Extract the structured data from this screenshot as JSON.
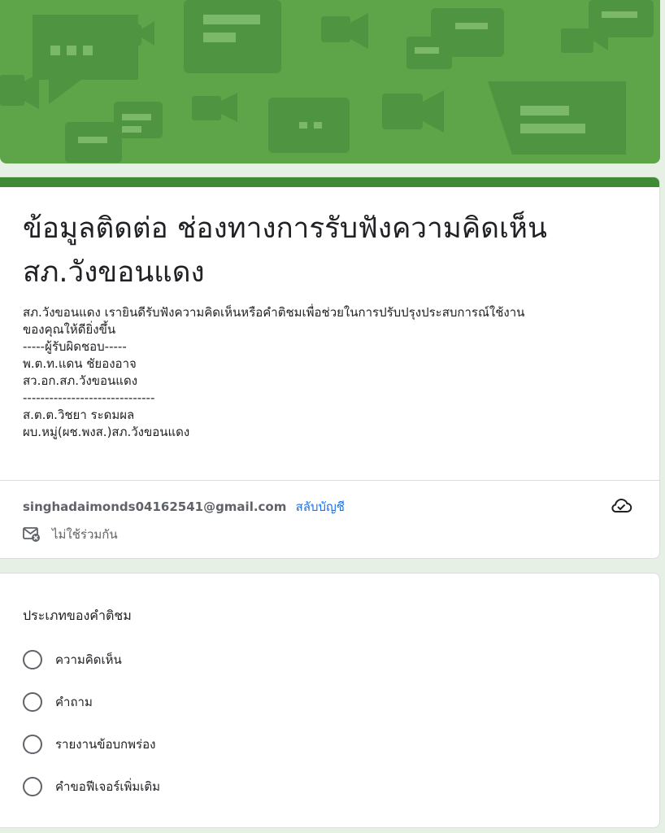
{
  "banner": {
    "color": "#5ea449",
    "icon": "chat-and-video-pattern"
  },
  "form": {
    "title_line1": "ข้อมูลติดต่อ ช่องทางการรับฟังความคิดเห็น",
    "title_line2": "สภ.วังขอนแดง",
    "accent_color": "#3e8a35",
    "description": [
      "สภ.วังขอนแดง เรายินดีรับฟังความคิดเห็นหรือคำติชมเพื่อช่วยในการปรับปรุงประสบการณ์ใช้งาน",
      "ของคุณให้ดียิ่งขึ้น",
      "-----ผู้รับผิดชอบ-----",
      "พ.ต.ท.แดน ชัยองอาจ",
      "สว.อก.สภ.วังขอนแดง",
      "------------------------------",
      "ส.ต.ต.วิชยา ระดมผล",
      "ผบ.หมู่(ผช.พงส.)สภ.วังขอนแดง"
    ]
  },
  "account": {
    "email": "singhadaimonds04162541@gmail.com",
    "switch_label": "สลับบัญชี",
    "not_shared_label": "ไม่ใช้ร่วมกัน",
    "cloud_icon": "cloud-check-icon",
    "not_shared_icon": "mail-off-icon",
    "link_color": "#1a73e8"
  },
  "question": {
    "title": "ประเภทของคำติชม",
    "options": [
      "ความคิดเห็น",
      "คำถาม",
      "รายงานข้อบกพร่อง",
      "คำขอฟีเจอร์เพิ่มเติม"
    ]
  }
}
